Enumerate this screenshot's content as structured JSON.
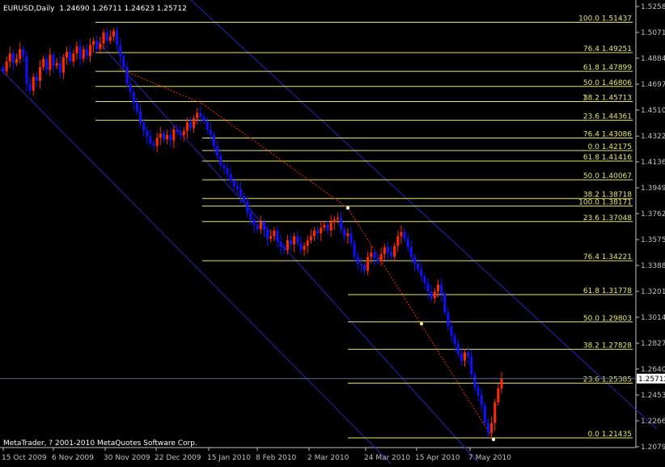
{
  "header": {
    "symbol_tf": "EURUSD,Daily",
    "ohlc": "1.24690 1.26711 1.24623 1.25712"
  },
  "footer": {
    "copyright": "MetaTrader, ? 2001-2010 MetaQuotes Software Corp."
  },
  "colors": {
    "background": "#000000",
    "axis": "#c0c0c0",
    "bull": "#ff2a00",
    "bear": "#1010ff",
    "fib": "#e8e86a",
    "channel": "#2424c0",
    "trend": "#ff2a00",
    "grid_text": "#c0c0c0"
  },
  "chart_data": {
    "type": "candlestick",
    "title": "EURUSD,Daily",
    "ylim": [
      1.2043,
      1.528
    ],
    "y_ticks": [
      "1.52580",
      "1.50710",
      "1.48840",
      "1.46970",
      "1.45100",
      "1.43220",
      "1.41360",
      "1.39490",
      "1.37620",
      "1.35750",
      "1.33880",
      "1.32010",
      "1.30140",
      "1.28270",
      "1.26400",
      "1.24530",
      "1.22660",
      "1.20790"
    ],
    "x_ticks": [
      "15 Oct 2009",
      "6 Nov 2009",
      "30 Nov 2009",
      "22 Dec 2009",
      "15 Jan 2010",
      "8 Feb 2010",
      "2 Mar 2010",
      "24 Mar 2010",
      "15 Apr 2010",
      "7 May 2010"
    ],
    "current_price": "1.25712",
    "current_value": 1.25712,
    "closes": [
      1.479,
      1.486,
      1.492,
      1.485,
      1.488,
      1.495,
      1.49,
      1.47,
      1.465,
      1.475,
      1.472,
      1.482,
      1.488,
      1.48,
      1.491,
      1.483,
      1.485,
      1.478,
      1.489,
      1.493,
      1.486,
      1.492,
      1.497,
      1.488,
      1.495,
      1.49,
      1.498,
      1.501,
      1.495,
      1.499,
      1.507,
      1.501,
      1.504,
      1.508,
      1.498,
      1.49,
      1.482,
      1.47,
      1.464,
      1.456,
      1.45,
      1.442,
      1.436,
      1.432,
      1.427,
      1.425,
      1.431,
      1.434,
      1.43,
      1.433,
      1.429,
      1.437,
      1.435,
      1.433,
      1.436,
      1.442,
      1.438,
      1.445,
      1.449,
      1.446,
      1.443,
      1.437,
      1.433,
      1.425,
      1.418,
      1.411,
      1.409,
      1.405,
      1.4,
      1.396,
      1.394,
      1.389,
      1.385,
      1.377,
      1.372,
      1.368,
      1.365,
      1.37,
      1.364,
      1.358,
      1.36,
      1.364,
      1.356,
      1.352,
      1.35,
      1.357,
      1.354,
      1.36,
      1.355,
      1.35,
      1.353,
      1.357,
      1.36,
      1.364,
      1.362,
      1.366,
      1.368,
      1.364,
      1.37,
      1.372,
      1.373,
      1.365,
      1.36,
      1.362,
      1.355,
      1.345,
      1.34,
      1.339,
      1.335,
      1.345,
      1.348,
      1.344,
      1.342,
      1.347,
      1.352,
      1.348,
      1.345,
      1.353,
      1.36,
      1.363,
      1.358,
      1.352,
      1.345,
      1.34,
      1.336,
      1.331,
      1.326,
      1.32,
      1.315,
      1.32,
      1.325,
      1.318,
      1.305,
      1.295,
      1.288,
      1.282,
      1.275,
      1.27,
      1.276,
      1.273,
      1.26,
      1.251,
      1.245,
      1.238,
      1.225,
      1.218,
      1.225,
      1.24,
      1.25,
      1.2571
    ]
  },
  "fib_levels": [
    {
      "label": "100.0  1.51437",
      "value": 1.51437
    },
    {
      "label": "76.4  1.49251",
      "value": 1.49251
    },
    {
      "label": "61.8  1.47899",
      "value": 1.47899
    },
    {
      "label": "50.0  1.46806",
      "value": 1.46806
    },
    {
      "label": "38.2  1.45713",
      "value": 1.45713
    },
    {
      "label": "23.6  1.44361",
      "value": 1.44361
    },
    {
      "label": "76.4  1.43086",
      "value": 1.43086
    },
    {
      "label": "0.0  1.42175",
      "value": 1.42175
    },
    {
      "label": "61.8  1.41416",
      "value": 1.41416
    },
    {
      "label": "50.0  1.40067",
      "value": 1.40067
    },
    {
      "label": "38.2  1.38718",
      "value": 1.38718
    },
    {
      "label": "100.0  1.38171",
      "value": 1.38171
    },
    {
      "label": "23.6  1.37048",
      "value": 1.37048
    },
    {
      "label": "76.4  1.34221",
      "value": 1.34221
    },
    {
      "label": "61.8  1.31778",
      "value": 1.31778
    },
    {
      "label": "50.0  1.29803",
      "value": 1.29803
    },
    {
      "label": "38.2  1.27828",
      "value": 1.27828
    },
    {
      "label": "23.6  1.25385",
      "value": 1.25385
    },
    {
      "label": "0.0  1.21435",
      "value": 1.21435
    }
  ],
  "fib_marker": "1"
}
